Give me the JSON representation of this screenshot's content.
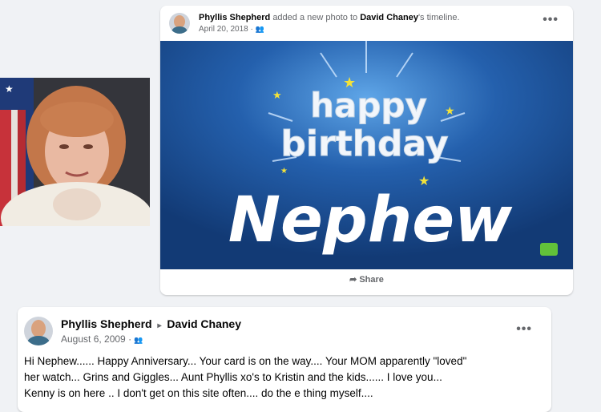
{
  "post1": {
    "author": "Phyllis Shepherd",
    "action": "added a new photo to",
    "target": "David Chaney",
    "target_suffix": "'s timeline.",
    "date": "April 20, 2018",
    "separator": "·",
    "audience_icon": "friends-icon",
    "more_label": "•••",
    "share_label": "Share",
    "image": {
      "line1": "happy",
      "line2": "birthday",
      "line3": "Nephew",
      "bg_color": "#1d4e92"
    }
  },
  "post2": {
    "author": "Phyllis Shepherd",
    "target": "David Chaney",
    "arrow": "▸",
    "date": "August 6, 2009",
    "separator": "·",
    "audience_icon": "friends-icon",
    "more_label": "•••",
    "body_line1": "Hi Nephew...... Happy Anniversary... Your card is on the way.... Your MOM apparently \"loved\"",
    "body_line2": "her watch... Grins and Giggles... Aunt Phyllis xo's to Kristin and the kids...... I love you...",
    "body_line3": "Kenny is on here .. I don't get on this site often.... do the e thing myself...."
  }
}
